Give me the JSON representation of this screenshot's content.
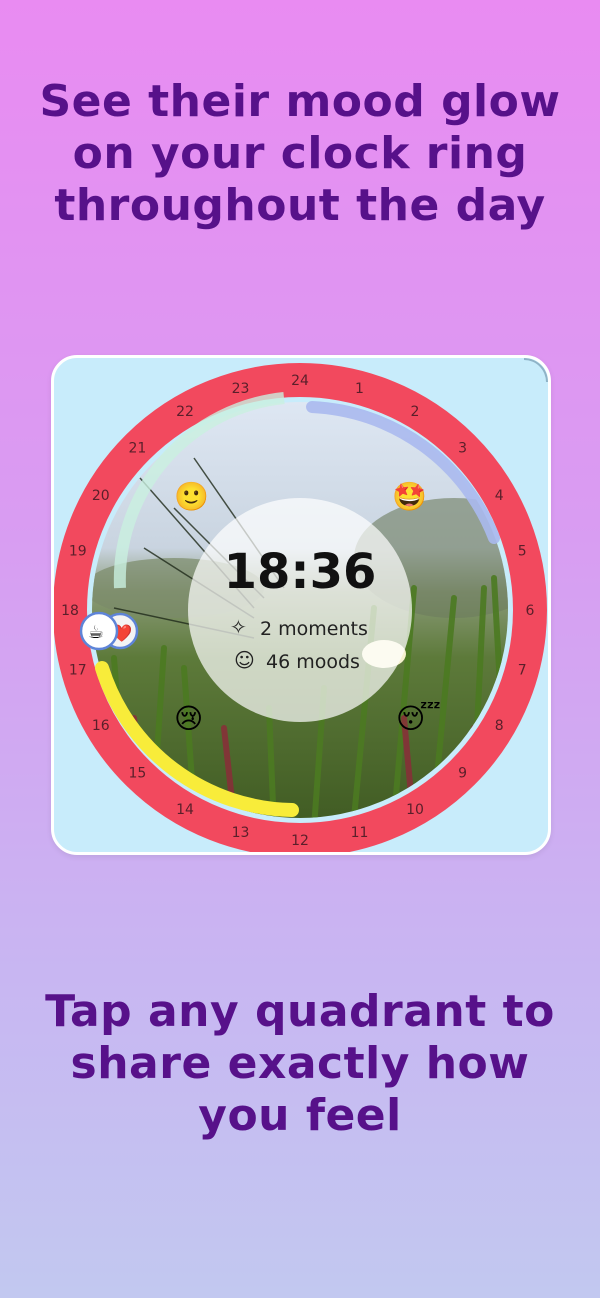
{
  "headline_top": {
    "line1": "See their mood glow",
    "line2": "on your clock ring",
    "line3": "throughout the day"
  },
  "clock": {
    "time": "18:36",
    "moments_label": "2 moments",
    "moods_label": "46 moods",
    "hours": [
      "24",
      "1",
      "2",
      "3",
      "4",
      "5",
      "6",
      "7",
      "8",
      "9",
      "10",
      "11",
      "12",
      "13",
      "14",
      "15",
      "16",
      "17",
      "18",
      "19",
      "20",
      "21",
      "22",
      "23"
    ],
    "ring_color": "#f2495e",
    "progress_color": "#f8ec3a",
    "moods": {
      "h20": "🙂",
      "h4": "🤩",
      "h16": "😢",
      "h8": "😴"
    },
    "avatar_icons": {
      "cup": "☕",
      "heart": "❤️"
    }
  },
  "headline_bottom": {
    "line1": "Tap any quadrant to",
    "line2": "share exactly how",
    "line3": "you feel"
  }
}
